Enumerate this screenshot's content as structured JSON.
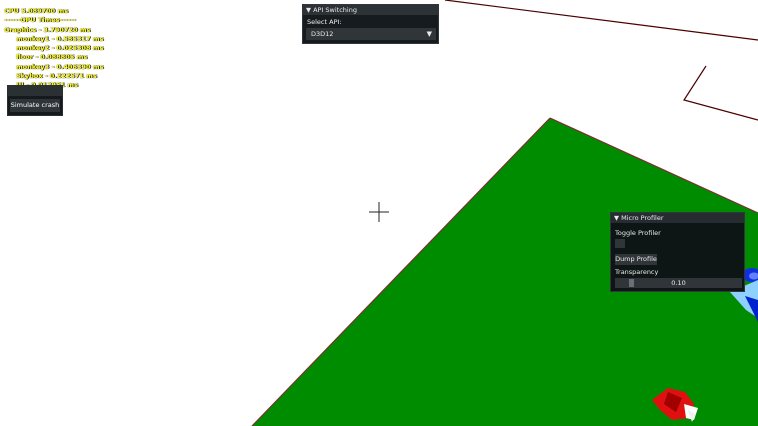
{
  "stats": {
    "cpu": "CPU 5.089700 ms",
    "gpu_header": "------GPU Times------",
    "graphics": "Graphics - 3.790720 ms",
    "items": [
      "monkey1 - 0.585317 ms",
      "monkey2 - 0.025308 ms",
      "floor - 0.088805 ms",
      "monkey3 - 0.406390 ms",
      "Skybox - 0.222571 ms",
      "UI - 0.012951 ms"
    ]
  },
  "crash": {
    "button_label": "Simulate crash"
  },
  "api_switching": {
    "title": "API Switching",
    "select_label": "Select API:",
    "selected": "D3D12"
  },
  "micro_profiler": {
    "title": "Micro Profiler",
    "toggle_label": "Toggle Profiler",
    "dump_label": "Dump Profile",
    "transparency_label": "Transparency",
    "transparency_value": "0.10"
  },
  "colors": {
    "floor": "#008c00",
    "floor_edge": "#7a3030",
    "stats_text": "#ffff22",
    "panel_bg": "#161b1e",
    "wire": "#4a0000"
  },
  "icons": {
    "crosshair": "crosshair-icon",
    "collapse": "triangle-down-icon"
  }
}
